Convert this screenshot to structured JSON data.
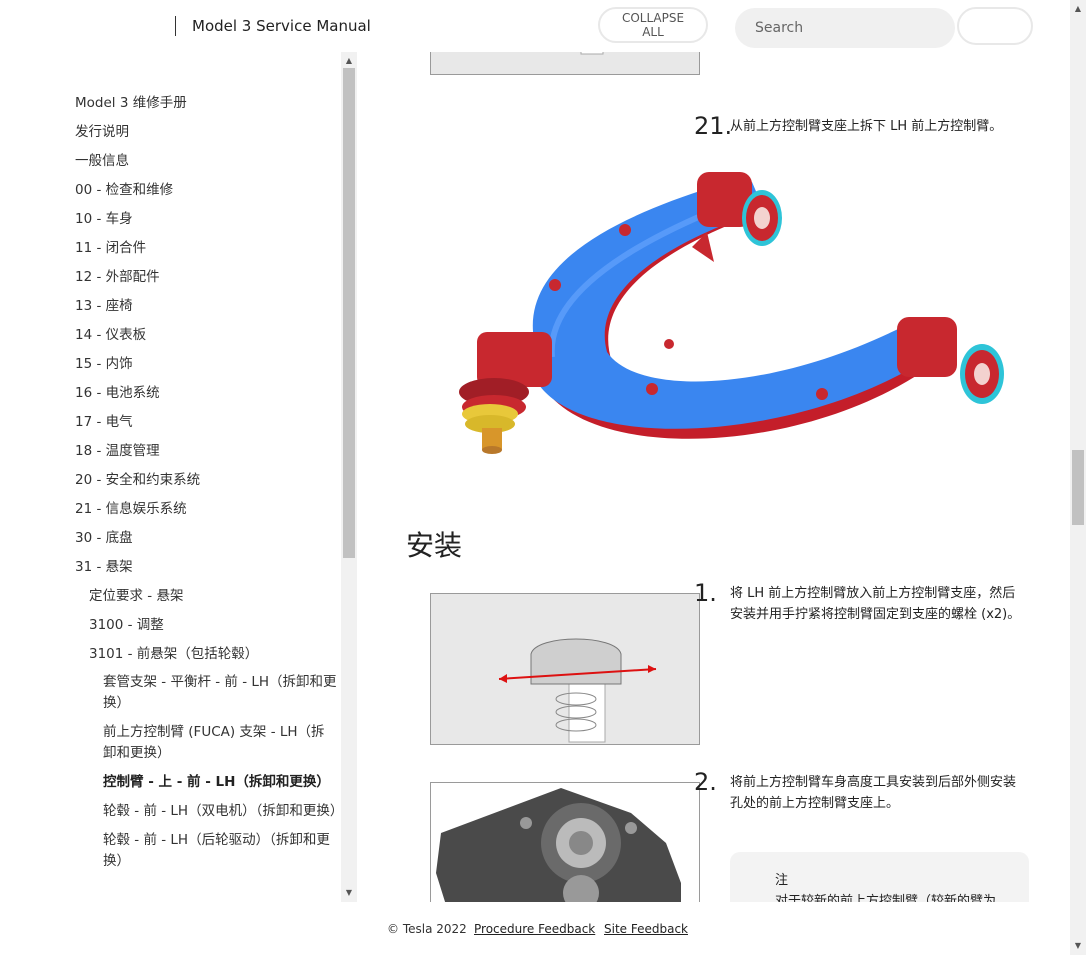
{
  "header": {
    "title": "Model 3 Service Manual",
    "collapse_line1": "COLLAPSE",
    "collapse_line2": "ALL",
    "search_placeholder": "Search"
  },
  "sidebar": {
    "items": [
      {
        "label": "Model 3 维修手册",
        "level": 1
      },
      {
        "label": "发行说明",
        "level": 1
      },
      {
        "label": "一般信息",
        "level": 1
      },
      {
        "label": "00 - 检查和维修",
        "level": 1
      },
      {
        "label": "10 - 车身",
        "level": 1
      },
      {
        "label": "11 - 闭合件",
        "level": 1
      },
      {
        "label": "12 - 外部配件",
        "level": 1
      },
      {
        "label": "13 - 座椅",
        "level": 1
      },
      {
        "label": "14 - 仪表板",
        "level": 1
      },
      {
        "label": "15 - 内饰",
        "level": 1
      },
      {
        "label": "16 - 电池系统",
        "level": 1
      },
      {
        "label": "17 - 电气",
        "level": 1
      },
      {
        "label": "18 - 温度管理",
        "level": 1
      },
      {
        "label": "20 - 安全和约束系统",
        "level": 1
      },
      {
        "label": "21 - 信息娱乐系统",
        "level": 1
      },
      {
        "label": "30 - 底盘",
        "level": 1
      },
      {
        "label": "31 - 悬架",
        "level": 1
      },
      {
        "label": "定位要求 - 悬架",
        "level": 2
      },
      {
        "label": "3100 - 调整",
        "level": 2
      },
      {
        "label": "3101 - 前悬架（包括轮毂）",
        "level": 2
      },
      {
        "label": "套管支架 - 平衡杆 - 前 - LH（拆卸和更换）",
        "level": 3
      },
      {
        "label": "前上方控制臂 (FUCA) 支架 - LH（拆卸和更换）",
        "level": 3
      },
      {
        "label": "控制臂 - 上 - 前 - LH（拆卸和更换）",
        "level": 3,
        "active": true
      },
      {
        "label": "轮毂 - 前 - LH（双电机）（拆卸和更换）",
        "level": 3
      },
      {
        "label": "轮毂 - 前 - LH（后轮驱动）（拆卸和更换）",
        "level": 3
      }
    ]
  },
  "main": {
    "step21": {
      "number": "21.",
      "text": "从前上方控制臂支座上拆下 LH 前上方控制臂。"
    },
    "install_heading": "安装",
    "step1": {
      "number": "1.",
      "text": "将 LH 前上方控制臂放入前上方控制臂支座，然后安装并用手拧紧将控制臂固定到支座的螺栓 (x2)。"
    },
    "step2": {
      "number": "2.",
      "text": "将前上方控制臂车身高度工具安装到后部外侧安装孔处的前上方控制臂支座上。"
    },
    "note": {
      "title": "注",
      "text": "对于较新的前上方控制臂（较新的臂为"
    }
  },
  "footer": {
    "copyright": "© Tesla 2022",
    "procedure_feedback": "Procedure Feedback",
    "site_feedback": "Site Feedback"
  },
  "colors": {
    "arm_blue": "#3a86f0",
    "bushing_red": "#c8282f",
    "arrow_red": "#d11"
  }
}
